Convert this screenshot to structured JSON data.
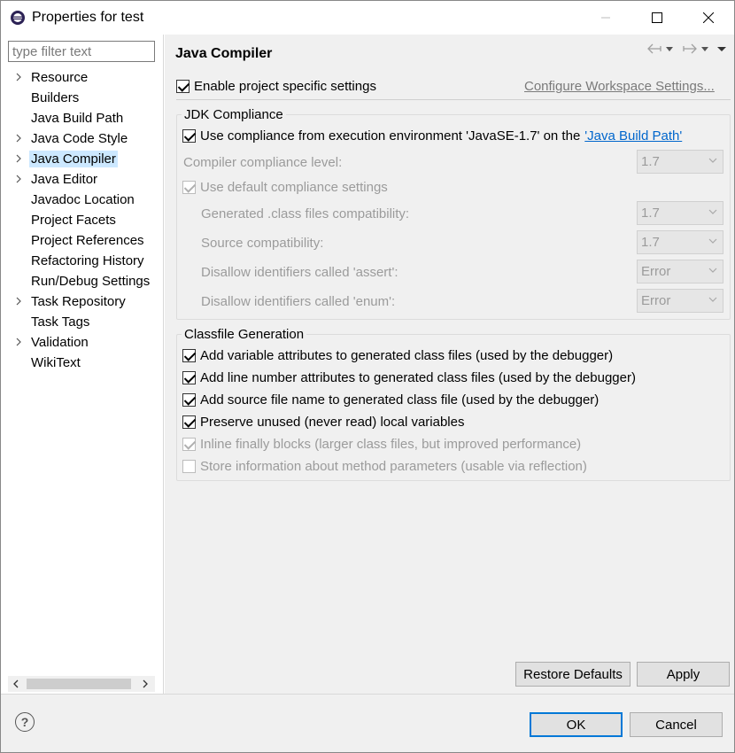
{
  "window": {
    "title": "Properties for test"
  },
  "filter": {
    "placeholder": "type filter text"
  },
  "tree": {
    "items": [
      {
        "label": "Resource",
        "expandable": true,
        "selected": false
      },
      {
        "label": "Builders",
        "expandable": false,
        "selected": false
      },
      {
        "label": "Java Build Path",
        "expandable": false,
        "selected": false
      },
      {
        "label": "Java Code Style",
        "expandable": true,
        "selected": false
      },
      {
        "label": "Java Compiler",
        "expandable": true,
        "selected": true
      },
      {
        "label": "Java Editor",
        "expandable": true,
        "selected": false
      },
      {
        "label": "Javadoc Location",
        "expandable": false,
        "selected": false
      },
      {
        "label": "Project Facets",
        "expandable": false,
        "selected": false
      },
      {
        "label": "Project References",
        "expandable": false,
        "selected": false
      },
      {
        "label": "Refactoring History",
        "expandable": false,
        "selected": false
      },
      {
        "label": "Run/Debug Settings",
        "expandable": false,
        "selected": false
      },
      {
        "label": "Task Repository",
        "expandable": true,
        "selected": false
      },
      {
        "label": "Task Tags",
        "expandable": false,
        "selected": false
      },
      {
        "label": "Validation",
        "expandable": true,
        "selected": false
      },
      {
        "label": "WikiText",
        "expandable": false,
        "selected": false
      }
    ]
  },
  "page": {
    "title": "Java Compiler",
    "enable_project_specific": {
      "label": "Enable project specific settings",
      "checked": true
    },
    "configure_workspace_link": "Configure Workspace Settings..."
  },
  "jdk": {
    "legend": "JDK Compliance",
    "use_compliance": {
      "label_prefix": "Use compliance from execution environment 'JavaSE-1.7' on the",
      "link": "'Java Build Path'",
      "checked": true
    },
    "compliance_level": {
      "label": "Compiler compliance level:",
      "value": "1.7"
    },
    "use_default": {
      "label": "Use default compliance settings",
      "checked": true
    },
    "generated_class": {
      "label": "Generated .class files compatibility:",
      "value": "1.7"
    },
    "source_compat": {
      "label": "Source compatibility:",
      "value": "1.7"
    },
    "disallow_assert": {
      "label": "Disallow identifiers called 'assert':",
      "value": "Error"
    },
    "disallow_enum": {
      "label": "Disallow identifiers called 'enum':",
      "value": "Error"
    }
  },
  "classfile": {
    "legend": "Classfile Generation",
    "options": [
      {
        "label": "Add variable attributes to generated class files (used by the debugger)",
        "checked": true,
        "enabled": true
      },
      {
        "label": "Add line number attributes to generated class files (used by the debugger)",
        "checked": true,
        "enabled": true
      },
      {
        "label": "Add source file name to generated class file (used by the debugger)",
        "checked": true,
        "enabled": true
      },
      {
        "label": "Preserve unused (never read) local variables",
        "checked": true,
        "enabled": true
      },
      {
        "label": "Inline finally blocks (larger class files, but improved performance)",
        "checked": true,
        "enabled": false
      },
      {
        "label": "Store information about method parameters (usable via reflection)",
        "checked": false,
        "enabled": false
      }
    ]
  },
  "buttons": {
    "restore_defaults": "Restore Defaults",
    "apply": "Apply",
    "ok": "OK",
    "cancel": "Cancel",
    "help": "?"
  }
}
